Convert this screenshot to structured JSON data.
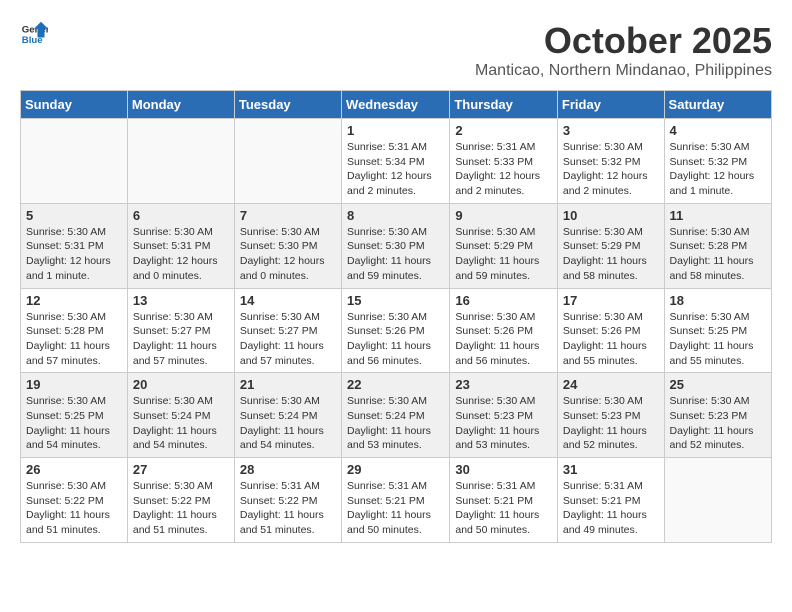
{
  "header": {
    "logo_general": "General",
    "logo_blue": "Blue",
    "month_title": "October 2025",
    "location": "Manticao, Northern Mindanao, Philippines"
  },
  "weekdays": [
    "Sunday",
    "Monday",
    "Tuesday",
    "Wednesday",
    "Thursday",
    "Friday",
    "Saturday"
  ],
  "weeks": [
    [
      {
        "day": "",
        "info": ""
      },
      {
        "day": "",
        "info": ""
      },
      {
        "day": "",
        "info": ""
      },
      {
        "day": "1",
        "info": "Sunrise: 5:31 AM\nSunset: 5:34 PM\nDaylight: 12 hours\nand 2 minutes."
      },
      {
        "day": "2",
        "info": "Sunrise: 5:31 AM\nSunset: 5:33 PM\nDaylight: 12 hours\nand 2 minutes."
      },
      {
        "day": "3",
        "info": "Sunrise: 5:30 AM\nSunset: 5:32 PM\nDaylight: 12 hours\nand 2 minutes."
      },
      {
        "day": "4",
        "info": "Sunrise: 5:30 AM\nSunset: 5:32 PM\nDaylight: 12 hours\nand 1 minute."
      }
    ],
    [
      {
        "day": "5",
        "info": "Sunrise: 5:30 AM\nSunset: 5:31 PM\nDaylight: 12 hours\nand 1 minute."
      },
      {
        "day": "6",
        "info": "Sunrise: 5:30 AM\nSunset: 5:31 PM\nDaylight: 12 hours\nand 0 minutes."
      },
      {
        "day": "7",
        "info": "Sunrise: 5:30 AM\nSunset: 5:30 PM\nDaylight: 12 hours\nand 0 minutes."
      },
      {
        "day": "8",
        "info": "Sunrise: 5:30 AM\nSunset: 5:30 PM\nDaylight: 11 hours\nand 59 minutes."
      },
      {
        "day": "9",
        "info": "Sunrise: 5:30 AM\nSunset: 5:29 PM\nDaylight: 11 hours\nand 59 minutes."
      },
      {
        "day": "10",
        "info": "Sunrise: 5:30 AM\nSunset: 5:29 PM\nDaylight: 11 hours\nand 58 minutes."
      },
      {
        "day": "11",
        "info": "Sunrise: 5:30 AM\nSunset: 5:28 PM\nDaylight: 11 hours\nand 58 minutes."
      }
    ],
    [
      {
        "day": "12",
        "info": "Sunrise: 5:30 AM\nSunset: 5:28 PM\nDaylight: 11 hours\nand 57 minutes."
      },
      {
        "day": "13",
        "info": "Sunrise: 5:30 AM\nSunset: 5:27 PM\nDaylight: 11 hours\nand 57 minutes."
      },
      {
        "day": "14",
        "info": "Sunrise: 5:30 AM\nSunset: 5:27 PM\nDaylight: 11 hours\nand 57 minutes."
      },
      {
        "day": "15",
        "info": "Sunrise: 5:30 AM\nSunset: 5:26 PM\nDaylight: 11 hours\nand 56 minutes."
      },
      {
        "day": "16",
        "info": "Sunrise: 5:30 AM\nSunset: 5:26 PM\nDaylight: 11 hours\nand 56 minutes."
      },
      {
        "day": "17",
        "info": "Sunrise: 5:30 AM\nSunset: 5:26 PM\nDaylight: 11 hours\nand 55 minutes."
      },
      {
        "day": "18",
        "info": "Sunrise: 5:30 AM\nSunset: 5:25 PM\nDaylight: 11 hours\nand 55 minutes."
      }
    ],
    [
      {
        "day": "19",
        "info": "Sunrise: 5:30 AM\nSunset: 5:25 PM\nDaylight: 11 hours\nand 54 minutes."
      },
      {
        "day": "20",
        "info": "Sunrise: 5:30 AM\nSunset: 5:24 PM\nDaylight: 11 hours\nand 54 minutes."
      },
      {
        "day": "21",
        "info": "Sunrise: 5:30 AM\nSunset: 5:24 PM\nDaylight: 11 hours\nand 54 minutes."
      },
      {
        "day": "22",
        "info": "Sunrise: 5:30 AM\nSunset: 5:24 PM\nDaylight: 11 hours\nand 53 minutes."
      },
      {
        "day": "23",
        "info": "Sunrise: 5:30 AM\nSunset: 5:23 PM\nDaylight: 11 hours\nand 53 minutes."
      },
      {
        "day": "24",
        "info": "Sunrise: 5:30 AM\nSunset: 5:23 PM\nDaylight: 11 hours\nand 52 minutes."
      },
      {
        "day": "25",
        "info": "Sunrise: 5:30 AM\nSunset: 5:23 PM\nDaylight: 11 hours\nand 52 minutes."
      }
    ],
    [
      {
        "day": "26",
        "info": "Sunrise: 5:30 AM\nSunset: 5:22 PM\nDaylight: 11 hours\nand 51 minutes."
      },
      {
        "day": "27",
        "info": "Sunrise: 5:30 AM\nSunset: 5:22 PM\nDaylight: 11 hours\nand 51 minutes."
      },
      {
        "day": "28",
        "info": "Sunrise: 5:31 AM\nSunset: 5:22 PM\nDaylight: 11 hours\nand 51 minutes."
      },
      {
        "day": "29",
        "info": "Sunrise: 5:31 AM\nSunset: 5:21 PM\nDaylight: 11 hours\nand 50 minutes."
      },
      {
        "day": "30",
        "info": "Sunrise: 5:31 AM\nSunset: 5:21 PM\nDaylight: 11 hours\nand 50 minutes."
      },
      {
        "day": "31",
        "info": "Sunrise: 5:31 AM\nSunset: 5:21 PM\nDaylight: 11 hours\nand 49 minutes."
      },
      {
        "day": "",
        "info": ""
      }
    ]
  ]
}
